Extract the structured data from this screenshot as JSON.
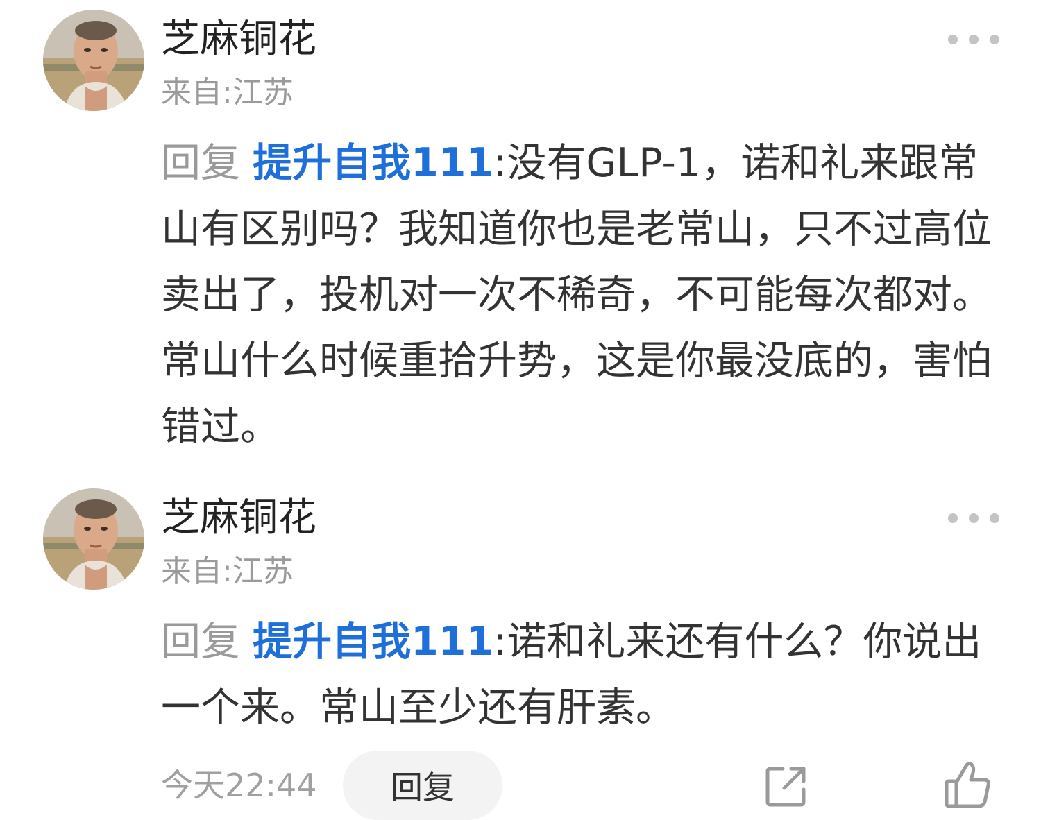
{
  "comments": [
    {
      "username": "芝麻铜花",
      "origin": "来自:江苏",
      "reply_word": "回复",
      "mention": "提升自我111",
      "separator": ":",
      "text": "没有GLP-1，诺和礼来跟常山有区别吗？我知道你也是老常山，只不过高位卖出了，投机对一次不稀奇，不可能每次都对。常山什么时候重拾升势，这是你最没底的，害怕错过。"
    },
    {
      "username": "芝麻铜花",
      "origin": "来自:江苏",
      "reply_word": "回复",
      "mention": "提升自我111",
      "separator": ":",
      "text": "诺和礼来还有什么？你说出一个来。常山至少还有肝素。"
    }
  ],
  "footer": {
    "timestamp": "今天22:44",
    "reply_button": "回复",
    "share_icon": "share-icon",
    "like_icon": "thumbs-up-icon"
  },
  "colors": {
    "mention": "#1e6fd9",
    "muted": "#9a9a9a",
    "text": "#333333",
    "button_bg": "#f3f3f3"
  }
}
